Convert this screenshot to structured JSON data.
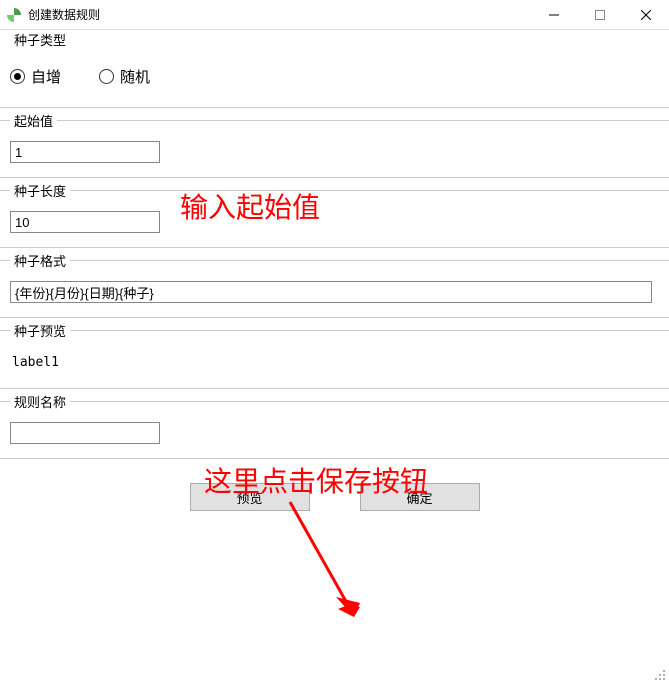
{
  "titlebar": {
    "title": "创建数据规则"
  },
  "groups": {
    "seed_type": {
      "label": "种子类型",
      "options": {
        "auto": "自增",
        "random": "随机"
      }
    },
    "start_value": {
      "label": "起始值",
      "value": "1"
    },
    "seed_length": {
      "label": "种子长度",
      "value": "10"
    },
    "seed_format": {
      "label": "种子格式",
      "value": "{年份}{月份}{日期}{种子}"
    },
    "seed_preview": {
      "label": "种子预览",
      "value": "label1"
    },
    "rule_name": {
      "label": "规则名称",
      "value": ""
    }
  },
  "buttons": {
    "preview": "预览",
    "ok": "确定"
  },
  "annotations": {
    "start_hint": "输入起始值",
    "save_hint": "这里点击保存按钮"
  }
}
